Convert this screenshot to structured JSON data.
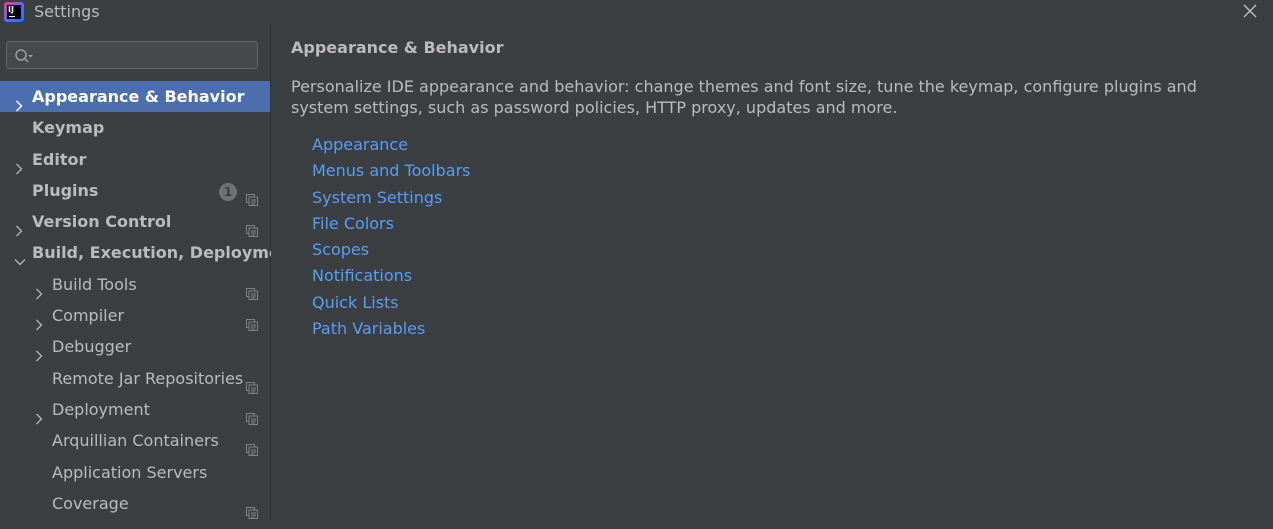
{
  "window": {
    "title": "Settings"
  },
  "search": {
    "value": "",
    "placeholder": ""
  },
  "sidebar": {
    "items": [
      {
        "label": "Appearance & Behavior",
        "level": 0,
        "expandable": true,
        "expanded": false,
        "selected": true,
        "bold": true,
        "badge": null,
        "project_icon": false
      },
      {
        "label": "Keymap",
        "level": 0,
        "expandable": false,
        "expanded": false,
        "selected": false,
        "bold": true,
        "badge": null,
        "project_icon": false
      },
      {
        "label": "Editor",
        "level": 0,
        "expandable": true,
        "expanded": false,
        "selected": false,
        "bold": true,
        "badge": null,
        "project_icon": false
      },
      {
        "label": "Plugins",
        "level": 0,
        "expandable": false,
        "expanded": false,
        "selected": false,
        "bold": true,
        "badge": "1",
        "project_icon": true
      },
      {
        "label": "Version Control",
        "level": 0,
        "expandable": true,
        "expanded": false,
        "selected": false,
        "bold": true,
        "badge": null,
        "project_icon": true
      },
      {
        "label": "Build, Execution, Deployment",
        "level": 0,
        "expandable": true,
        "expanded": true,
        "selected": false,
        "bold": true,
        "badge": null,
        "project_icon": false
      },
      {
        "label": "Build Tools",
        "level": 1,
        "expandable": true,
        "expanded": false,
        "selected": false,
        "bold": false,
        "badge": null,
        "project_icon": true
      },
      {
        "label": "Compiler",
        "level": 1,
        "expandable": true,
        "expanded": false,
        "selected": false,
        "bold": false,
        "badge": null,
        "project_icon": true
      },
      {
        "label": "Debugger",
        "level": 1,
        "expandable": true,
        "expanded": false,
        "selected": false,
        "bold": false,
        "badge": null,
        "project_icon": false
      },
      {
        "label": "Remote Jar Repositories",
        "level": 1,
        "expandable": false,
        "expanded": false,
        "selected": false,
        "bold": false,
        "badge": null,
        "project_icon": true
      },
      {
        "label": "Deployment",
        "level": 1,
        "expandable": true,
        "expanded": false,
        "selected": false,
        "bold": false,
        "badge": null,
        "project_icon": true
      },
      {
        "label": "Arquillian Containers",
        "level": 1,
        "expandable": false,
        "expanded": false,
        "selected": false,
        "bold": false,
        "badge": null,
        "project_icon": true
      },
      {
        "label": "Application Servers",
        "level": 1,
        "expandable": false,
        "expanded": false,
        "selected": false,
        "bold": false,
        "badge": null,
        "project_icon": false
      },
      {
        "label": "Coverage",
        "level": 1,
        "expandable": false,
        "expanded": false,
        "selected": false,
        "bold": false,
        "badge": null,
        "project_icon": true
      }
    ]
  },
  "main": {
    "title": "Appearance & Behavior",
    "description": "Personalize IDE appearance and behavior: change themes and font size, tune the keymap, configure plugins and system settings, such as password policies, HTTP proxy, updates and more.",
    "links": [
      "Appearance",
      "Menus and Toolbars",
      "System Settings",
      "File Colors",
      "Scopes",
      "Notifications",
      "Quick Lists",
      "Path Variables"
    ]
  },
  "colors": {
    "background": "#3c3f41",
    "selection": "#4b6eaf",
    "link": "#589df6",
    "text": "#bbbbbb",
    "badge": "#6e7172"
  }
}
